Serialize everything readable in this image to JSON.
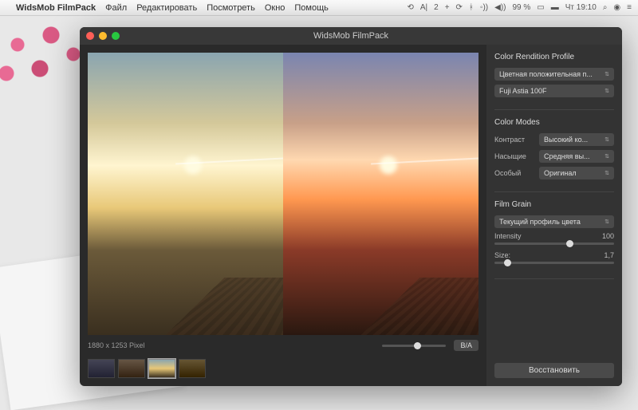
{
  "menubar": {
    "app_name": "WidsMob FilmPack",
    "items": [
      "Файл",
      "Редактировать",
      "Посмотреть",
      "Окно",
      "Помощь"
    ],
    "status": {
      "battery": "99 %",
      "clock": "Чт 19:10"
    }
  },
  "window": {
    "title": "WidsMob FilmPack",
    "dimensions": "1880 x 1253 Pixel",
    "ba_label": "B/A"
  },
  "panel": {
    "rendition": {
      "heading": "Color Rendition Profile",
      "type": "Цветная положительная п...",
      "film": "Fuji Astia 100F"
    },
    "modes": {
      "heading": "Color Modes",
      "rows": [
        {
          "label": "Контраст",
          "value": "Высокий ко..."
        },
        {
          "label": "Насыщие",
          "value": "Средняя вы..."
        },
        {
          "label": "Особый",
          "value": "Оригинал"
        }
      ]
    },
    "grain": {
      "heading": "Film Grain",
      "profile": "Текущий профиль цвета",
      "intensity_label": "Intensity",
      "intensity_value": "100",
      "size_label": "Size:",
      "size_value": "1,7"
    },
    "restore": "Восстановить"
  }
}
